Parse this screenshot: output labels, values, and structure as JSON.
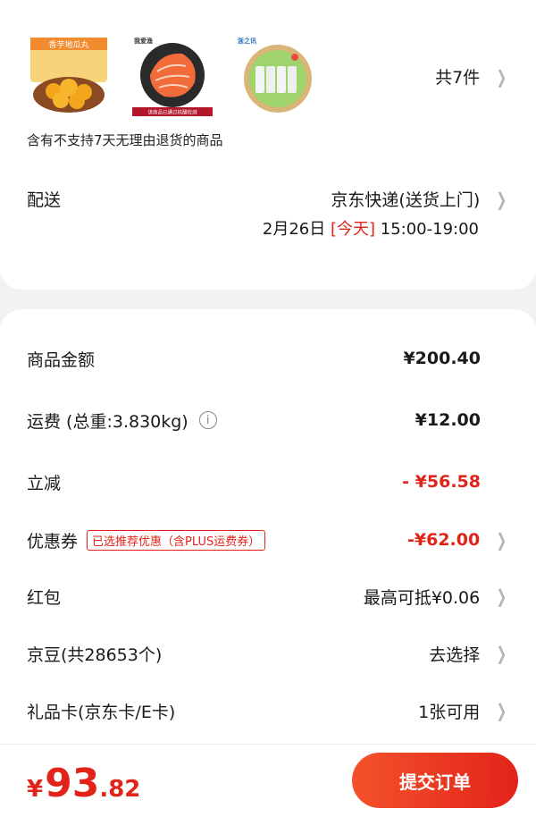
{
  "products": {
    "count_label": "共7件",
    "items": [
      {
        "brand": "香芋地瓜丸"
      },
      {
        "brand": "我爱渔",
        "caption": "该商品已通过核酸检测"
      },
      {
        "brand": "浙之讯"
      }
    ]
  },
  "notice": "含有不支持7天无理由退货的商品",
  "delivery": {
    "label": "配送",
    "method": "京东快递(送货上门)",
    "date": "2月26日",
    "today": "[今天]",
    "time": "15:00-19:00"
  },
  "summary": {
    "goods_label": "商品金额",
    "goods_value": "¥200.40",
    "freight_label": "运费 (总重:3.830kg)",
    "freight_info_icon": "i",
    "freight_value": "¥12.00",
    "discount_label": "立减",
    "discount_value": "- ¥56.58",
    "coupon_label": "优惠券",
    "coupon_tag": "已选推荐优惠（含PLUS运费券）",
    "coupon_value": "-¥62.00",
    "redpacket_label": "红包",
    "redpacket_value": "最高可抵¥0.06",
    "beans_label": "京豆(共28653个)",
    "beans_value": "去选择",
    "giftcard_label": "礼品卡(京东卡/E卡)",
    "giftcard_value": "1张可用"
  },
  "footer": {
    "yen": "¥",
    "total_int": "93",
    "total_dec": ".82",
    "submit_label": "提交订单"
  },
  "icons": {
    "chevron": "chevron-right-icon",
    "info": "info-icon"
  },
  "colors": {
    "accent": "#e2231a",
    "submit_start": "#f4522b"
  }
}
